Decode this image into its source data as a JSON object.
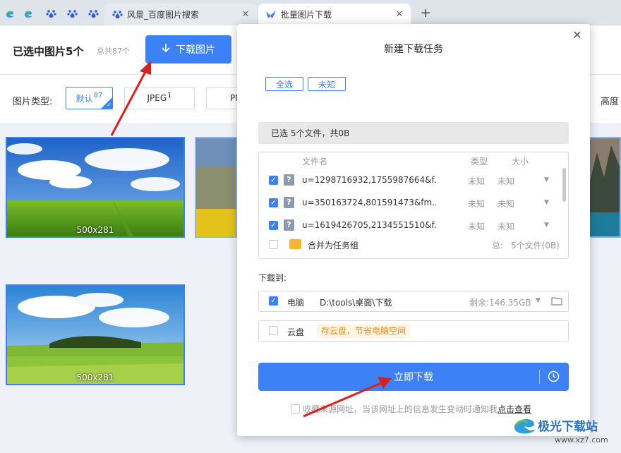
{
  "tabs": [
    {
      "label": "风景_百度图片搜索",
      "close": "✕"
    },
    {
      "label": "批量图片下载",
      "close": "✕"
    }
  ],
  "new_tab": "+",
  "topbar": {
    "selected": "已选中图片5个",
    "total": "总共87个",
    "download_button": "下载图片"
  },
  "filters": {
    "label": "图片类型:",
    "chips": [
      {
        "label": "默认",
        "count": "87"
      },
      {
        "label": "JPEG",
        "count": "1"
      },
      {
        "label": "PN",
        "count": ""
      }
    ],
    "height_label": "高度"
  },
  "gallery": {
    "images": [
      {
        "dim": "500x281"
      },
      {
        "dim": "500x281"
      }
    ]
  },
  "modal": {
    "title": "新建下载任务",
    "close": "✕",
    "select_all": "全选",
    "unknown": "未知",
    "summary": "已选 5个文件，共0B",
    "columns": {
      "name": "文件名",
      "type": "类型",
      "size": "大小"
    },
    "files": [
      {
        "name": "u=1298716932,1755987664&f...",
        "type": "未知",
        "size": "未知"
      },
      {
        "name": "u=350163724,801591473&fm...",
        "type": "未知",
        "size": "未知"
      },
      {
        "name": "u=1619426705,2134551510&f...",
        "type": "未知",
        "size": "未知"
      }
    ],
    "merge_label": "合并为任务组",
    "merge_total": "总:",
    "merge_count": "5个文件(0B)",
    "download_to": "下载到:",
    "pc_label": "电脑",
    "pc_path": "D:\\tools\\桌面\\下载",
    "pc_free": "剩余:146.35GB",
    "cloud_label": "云盘",
    "cloud_promo": "存云盘，节省电脑空间",
    "download_now": "立即下载",
    "footer_text": "收藏来源网址，当该网址上的信息发生变动时通知我",
    "footer_link": "点击查看"
  },
  "watermark": {
    "brand": "极光下载站",
    "url": "www.xz7.com"
  },
  "colors": {
    "accent": "#3c82f6",
    "promo_bg": "#fff5e5",
    "promo_text": "#e78b20",
    "annotation_arrow": "#d9201f"
  },
  "icons": [
    "edge-icon",
    "baidu-paw-icon",
    "bird-icon",
    "download-arrow-icon",
    "question-icon",
    "folder-icon",
    "clock-icon",
    "close-icon",
    "dropdown-icon"
  ]
}
